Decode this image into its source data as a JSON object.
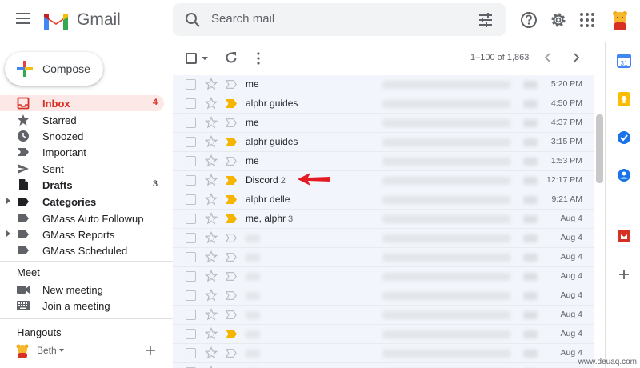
{
  "header": {
    "app_name": "Gmail",
    "search_placeholder": "Search mail"
  },
  "compose": {
    "label": "Compose"
  },
  "nav": [
    {
      "id": "inbox",
      "label": "Inbox",
      "count": "4",
      "icon": "inbox-icon",
      "active": true
    },
    {
      "id": "starred",
      "label": "Starred",
      "count": "",
      "icon": "star-icon"
    },
    {
      "id": "snoozed",
      "label": "Snoozed",
      "count": "",
      "icon": "clock-icon"
    },
    {
      "id": "important",
      "label": "Important",
      "count": "",
      "icon": "important-icon"
    },
    {
      "id": "sent",
      "label": "Sent",
      "count": "",
      "icon": "send-icon"
    },
    {
      "id": "drafts",
      "label": "Drafts",
      "count": "3",
      "icon": "draft-icon"
    },
    {
      "id": "categories",
      "label": "Categories",
      "count": "",
      "icon": "label-icon"
    },
    {
      "id": "gmass-followup",
      "label": "GMass Auto Followup",
      "count": "",
      "icon": "label-icon"
    },
    {
      "id": "gmass-reports",
      "label": "GMass Reports",
      "count": "",
      "icon": "label-icon"
    },
    {
      "id": "gmass-scheduled",
      "label": "GMass Scheduled",
      "count": "",
      "icon": "label-icon"
    }
  ],
  "meet": {
    "title": "Meet",
    "items": [
      {
        "label": "New meeting",
        "icon": "video-camera-icon"
      },
      {
        "label": "Join a meeting",
        "icon": "keyboard-icon"
      }
    ]
  },
  "hangouts": {
    "title": "Hangouts",
    "user": "Beth"
  },
  "toolbar": {
    "page_range": "1–100 of 1,863"
  },
  "emails": [
    {
      "sender": "me",
      "thread_count": "",
      "time": "5:20 PM",
      "important": false,
      "blurred_sender": false
    },
    {
      "sender": "alphr guides",
      "thread_count": "",
      "time": "4:50 PM",
      "important": true,
      "blurred_sender": false
    },
    {
      "sender": "me",
      "thread_count": "",
      "time": "4:37 PM",
      "important": false,
      "blurred_sender": false
    },
    {
      "sender": "alphr guides",
      "thread_count": "",
      "time": "3:15 PM",
      "important": true,
      "blurred_sender": false
    },
    {
      "sender": "me",
      "thread_count": "",
      "time": "1:53 PM",
      "important": false,
      "blurred_sender": false
    },
    {
      "sender": "Discord",
      "thread_count": "2",
      "time": "12:17 PM",
      "important": true,
      "blurred_sender": false
    },
    {
      "sender": "alphr delle",
      "thread_count": "",
      "time": "9:21 AM",
      "important": true,
      "blurred_sender": false
    },
    {
      "sender": "me, alphr",
      "thread_count": "3",
      "time": "Aug 4",
      "important": true,
      "blurred_sender": false
    },
    {
      "sender": "",
      "thread_count": "",
      "time": "Aug 4",
      "important": false,
      "blurred_sender": true
    },
    {
      "sender": "",
      "thread_count": "",
      "time": "Aug 4",
      "important": false,
      "blurred_sender": true
    },
    {
      "sender": "",
      "thread_count": "",
      "time": "Aug 4",
      "important": false,
      "blurred_sender": true
    },
    {
      "sender": "",
      "thread_count": "",
      "time": "Aug 4",
      "important": false,
      "blurred_sender": true
    },
    {
      "sender": "",
      "thread_count": "",
      "time": "Aug 4",
      "important": false,
      "blurred_sender": true
    },
    {
      "sender": "",
      "thread_count": "",
      "time": "Aug 4",
      "important": true,
      "blurred_sender": true
    },
    {
      "sender": "",
      "thread_count": "",
      "time": "Aug 4",
      "important": false,
      "blurred_sender": true
    },
    {
      "sender": "",
      "thread_count": "",
      "time": "",
      "important": false,
      "blurred_sender": true
    }
  ],
  "side_panel": [
    "calendar-icon",
    "keep-icon",
    "tasks-icon",
    "contacts-icon",
    "addon-icon",
    "add-icon"
  ],
  "watermark": "www.deuaq.com",
  "colors": {
    "accent_red": "#d93025",
    "important_yellow": "#f4b400",
    "selected_bg": "#fce8e6",
    "list_bg": "#f2f6fc"
  }
}
